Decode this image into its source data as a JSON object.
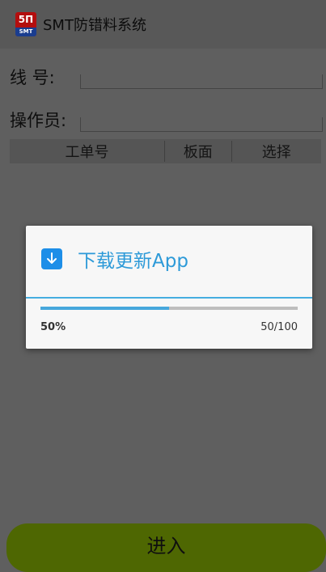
{
  "titlebar": {
    "icon_glyph": "5Π",
    "icon_sub": "SMT",
    "title": "SMT防错料系统"
  },
  "form": {
    "line_label": "线    号:",
    "line_value": "",
    "operator_label": "操作员:",
    "operator_value": ""
  },
  "table": {
    "headers": [
      "工单号",
      "板面",
      "选择"
    ]
  },
  "dialog": {
    "title": "下载更新App",
    "percent_text": "50%",
    "count_text": "50/100",
    "progress": 0.5
  },
  "enter_button": {
    "label": "进入"
  },
  "colors": {
    "accent": "#46a7dc",
    "button": "#4e6702",
    "brand_red": "#b30e0e"
  }
}
